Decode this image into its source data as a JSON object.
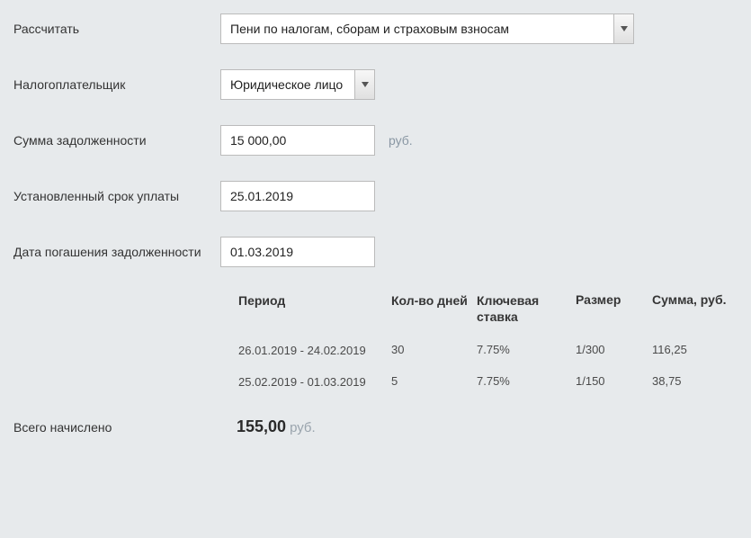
{
  "labels": {
    "calculate": "Рассчитать",
    "taxpayer": "Налогоплательщик",
    "debt_amount": "Сумма задолженности",
    "due_date": "Установленный срок уплаты",
    "repay_date": "Дата погашения задолженности",
    "total": "Всего начислено",
    "currency_unit": "руб."
  },
  "inputs": {
    "calculate_type": "Пени по налогам, сборам и страховым взносам",
    "taxpayer_type": "Юридическое лицо",
    "debt_amount": "15 000,00",
    "due_date": "25.01.2019",
    "repay_date": "01.03.2019"
  },
  "table": {
    "headers": {
      "period": "Период",
      "days": "Кол-во дней",
      "key_rate": "Ключевая ставка",
      "size": "Размер",
      "sum": "Сумма, руб."
    },
    "rows": [
      {
        "period": "26.01.2019 - 24.02.2019",
        "days": "30",
        "key_rate": "7.75%",
        "size": "1/300",
        "sum": "116,25"
      },
      {
        "period": "25.02.2019 - 01.03.2019",
        "days": "5",
        "key_rate": "7.75%",
        "size": "1/150",
        "sum": "38,75"
      }
    ]
  },
  "total": {
    "value": "155,00",
    "unit": "руб."
  }
}
